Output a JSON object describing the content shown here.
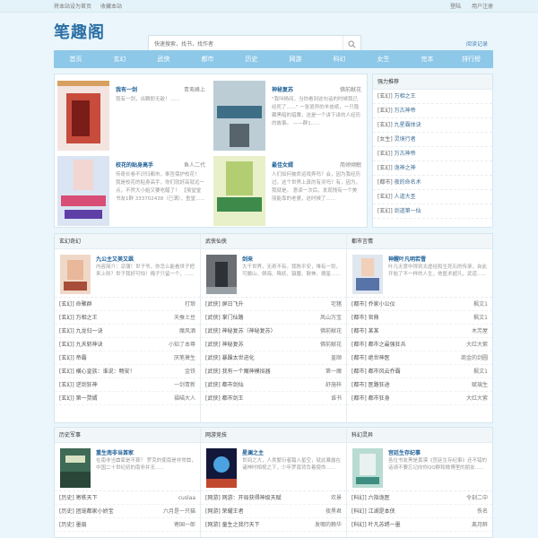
{
  "topbar": {
    "set_home": "将本站设为首页",
    "bookmark": "收藏本站",
    "login": "登陆",
    "register": "用户注册"
  },
  "header": {
    "logo": "笔趣阁",
    "search_placeholder": "快速搜索，找书，找作者",
    "history": "阅读记录"
  },
  "nav": [
    "首页",
    "玄幻",
    "武侠",
    "都市",
    "历史",
    "网游",
    "科幻",
    "女生",
    "完本",
    "排行榜"
  ],
  "featured": [
    {
      "title": "我有一剑",
      "author": "青鸾峰上",
      "desc": "我有一剑，出鞘即无敌！......"
    },
    {
      "title": "神秘复苏",
      "author": "佛前献花",
      "desc": "\"我叫杨间，当你看到这句话的时候我已经死了......\" 一张诡异的羊皮纸，一只隐藏黑暗的猎鹰，这是一个讲下讲的人经历的故事。  ——群1......"
    },
    {
      "title": "校花的贴身高手",
      "author": "鱼人二代",
      "desc": "传奇长卷不识归都市，奉旨保护校花！  我是校花的贴身高手，你们就好高就远一点，不然大小姐又要吃醋了！ 【虽堂堂书友1群 333702438（已满），鱼堂......"
    },
    {
      "title": "最佳女婿",
      "author": "简倾倾眠",
      "desc": "人们如何被命运戏弄吗？会，因为我经历过。这个世界上真的有灵吗？有，因为，我就是。 意读一次后，发现残有一个美丽能靠的老婆，这时候了......"
    }
  ],
  "rank": {
    "title": "强力推荐",
    "items": [
      {
        "cat": "[玄幻]",
        "name": "万相之王"
      },
      {
        "cat": "[玄幻]",
        "name": "万古神帝"
      },
      {
        "cat": "[玄幻]",
        "name": "九星霸体诀"
      },
      {
        "cat": "[女生]",
        "name": "灵境行者"
      },
      {
        "cat": "[玄幻]",
        "name": "万古神帝"
      },
      {
        "cat": "[玄幻]",
        "name": "诡神之神"
      },
      {
        "cat": "[都市]",
        "name": "夜的命名术"
      },
      {
        "cat": "[玄幻]",
        "name": "人道大圣"
      },
      {
        "cat": "[玄幻]",
        "name": "剑道第一仙"
      }
    ]
  },
  "sections": [
    {
      "title": "玄幻奇幻",
      "feat": {
        "title": "九公主又美又飒",
        "desc": "内容简介：凉薄！世子爷，你怎么能看世子把来上则？世子我好可怕！掩子只留一个，......"
      },
      "list": [
        {
          "t": "[玄幻] 命聚群",
          "a": "打琅"
        },
        {
          "t": "[玄幻] 万相之王",
          "a": "天蚕土豆"
        },
        {
          "t": "[玄幻] 九龙归一诀",
          "a": "魔风酒"
        },
        {
          "t": "[玄幻] 九天斩神诀",
          "a": "小知了本尊"
        },
        {
          "t": "[玄幻] 帝霸",
          "a": "厌笔萧生"
        },
        {
          "t": "[玄幻] 横心皇族：谁说：畅安！",
          "a": "金铁"
        },
        {
          "t": "[玄幻] 逆剑狂神",
          "a": "一剑青新"
        },
        {
          "t": "[玄幻] 第一赘婿",
          "a": "福喵大人"
        }
      ]
    },
    {
      "title": "武侠仙侠",
      "feat": {
        "title": "剑来",
        "desc": "大千世界，无奇不有。我陈平安，唯有一剑，可搬山、倒海、降妖、镇魔、敕神、摘星......"
      },
      "list": [
        {
          "t": "[武侠] 屏日飞升",
          "a": "宅猪"
        },
        {
          "t": "[武侠] 掌门仙路",
          "a": "风山万宝"
        },
        {
          "t": "[武侠] 神秘复苏（神秘复苏）",
          "a": "佛前献花"
        },
        {
          "t": "[武侠] 神秘复苏",
          "a": "佛前献花"
        },
        {
          "t": "[武侠] 暴躁太世进化",
          "a": "盖顺"
        },
        {
          "t": "[武侠] 我有一个魔神模拟器",
          "a": "第一魔"
        },
        {
          "t": "[武侠] 都市剑仙",
          "a": "舒施梓"
        },
        {
          "t": "[武侠] 都市剑王",
          "a": "谁书"
        }
      ]
    },
    {
      "title": "都市言情",
      "feat": {
        "title": "神醒叶凡明若雪",
        "desc": "叶凡无意中得到太虚经和生死石的传承，自此开始了不一样的人生，他医术超凡，武道......"
      },
      "list": [
        {
          "t": "[都市] 乔家小公仪",
          "a": "枫文1"
        },
        {
          "t": "[都市] 官鼎",
          "a": "枫文1"
        },
        {
          "t": "[都市] 某某",
          "a": "木芳屋"
        },
        {
          "t": "[都市] 都市之最强狂兵",
          "a": "大红大紫"
        },
        {
          "t": "[都市] 绝世神医",
          "a": "商金的剑圆"
        },
        {
          "t": "[都市] 都市风云乔霸",
          "a": "枫文1"
        },
        {
          "t": "[都市] 医路狂途",
          "a": "赋璃生"
        },
        {
          "t": "[都市] 都市狂身",
          "a": "大红大紫"
        }
      ]
    }
  ],
  "sections2": [
    {
      "title": "历史军事",
      "feat": {
        "title": "重生南非当酋家",
        "desc": "在南非当酋家是不算？ 罗克的使南是非常酋， 中国二十世纪初的南非并无......"
      },
      "list": [
        {
          "t": "[历史] 寄秩天下",
          "a": "cuslaa"
        },
        {
          "t": "[历史] 团宠都家小娇宝",
          "a": "六月是一只猫"
        },
        {
          "t": "[历史] 墨扇",
          "a": "寄国一郎"
        }
      ]
    },
    {
      "title": "网游竞技",
      "feat": {
        "title": "星澜之主",
        "desc": "世间之大，人类繁衍者踏入星空，就此暴露在诸神时相视之下，少年罗南背负着使命......"
      },
      "list": [
        {
          "t": "[网游] 网游：开局获得神级天赋",
          "a": "欢景"
        },
        {
          "t": "[网游] 荣耀王者",
          "a": "夜黑君"
        },
        {
          "t": "[网游] 童生之我行天下",
          "a": "发哪的赖华"
        }
      ]
    },
    {
      "title": "科幻灵异",
      "feat": {
        "title": "宫廷生存纪事",
        "desc": "各位书友黑是黄漠《宫廷生存纪事》还不错的话请不要忘记向你QQ群和微博里的朋友......"
      },
      "list": [
        {
          "t": "[科幻] 六指诡医",
          "a": "令刻二中"
        },
        {
          "t": "[科幻] 江湖是本侠",
          "a": "佚名"
        },
        {
          "t": "[科幻] 叶凡苏绣一墨",
          "a": "离月醉"
        }
      ]
    }
  ],
  "colors": {
    "nav_bg": "#8ec8e8",
    "link": "#1d5f96",
    "page_bg": "#eaf6fb"
  }
}
